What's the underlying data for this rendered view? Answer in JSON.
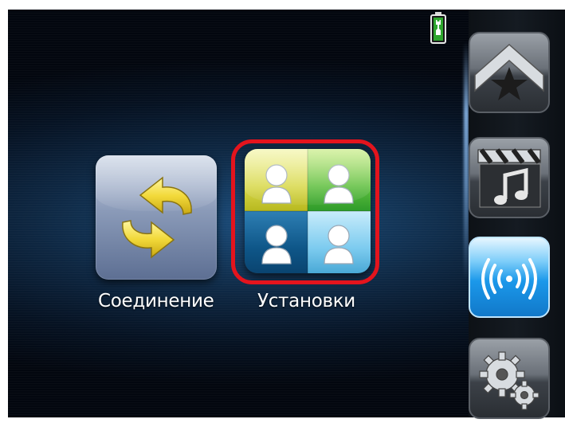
{
  "apps": [
    {
      "id": "connect",
      "label": "Соединение",
      "icon": "sync-arrows-icon"
    },
    {
      "id": "settings",
      "label": "Установки",
      "icon": "users-grid-icon",
      "selected": true
    }
  ],
  "status": {
    "battery_icon": "battery-charging-icon"
  },
  "sidebar": {
    "items": [
      {
        "id": "home",
        "icon": "home-star-icon",
        "active": false
      },
      {
        "id": "media",
        "icon": "media-clapper-note-icon",
        "active": false
      },
      {
        "id": "connect",
        "icon": "wireless-signal-icon",
        "active": true
      },
      {
        "id": "settings",
        "icon": "gears-icon",
        "active": false
      }
    ]
  },
  "colors": {
    "selection": "#e4141d",
    "active_button": "#1b98ea",
    "background": "#0e2742"
  }
}
